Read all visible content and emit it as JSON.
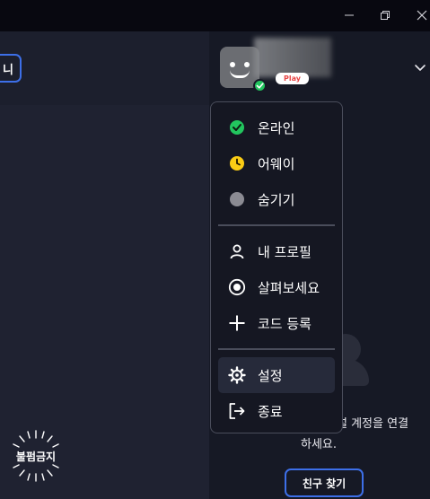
{
  "window": {
    "controls": [
      "minimize-icon",
      "restore-icon",
      "close-icon"
    ]
  },
  "left": {
    "button_label": "니",
    "dnd_label": "불펌금지"
  },
  "profile": {
    "tag_label": "Play",
    "status_color": "#22c55e"
  },
  "menu": {
    "status_items": [
      {
        "label": "온라인",
        "icon": "online-status-icon",
        "color": "#22c55e"
      },
      {
        "label": "어웨이",
        "icon": "away-clock-icon",
        "color": "#facc15"
      },
      {
        "label": "숨기기",
        "icon": "hidden-status-icon",
        "color": "#8b8b93"
      }
    ],
    "nav_items": [
      {
        "label": "내 프로필",
        "icon": "person-icon"
      },
      {
        "label": "살펴보세요",
        "icon": "radio-target-icon"
      },
      {
        "label": "코드 등록",
        "icon": "plus-icon"
      }
    ],
    "system_items": [
      {
        "label": "설정",
        "icon": "gear-icon"
      },
      {
        "label": "종료",
        "icon": "logout-icon"
      }
    ]
  },
  "empty_state": {
    "line1": "설 계정을 연결",
    "line2": "하세요.",
    "button_label": "친구 찾기"
  },
  "colors": {
    "accent": "#3d6fe8",
    "menu_bg": "#151722",
    "active_item_bg": "#262a3a"
  }
}
